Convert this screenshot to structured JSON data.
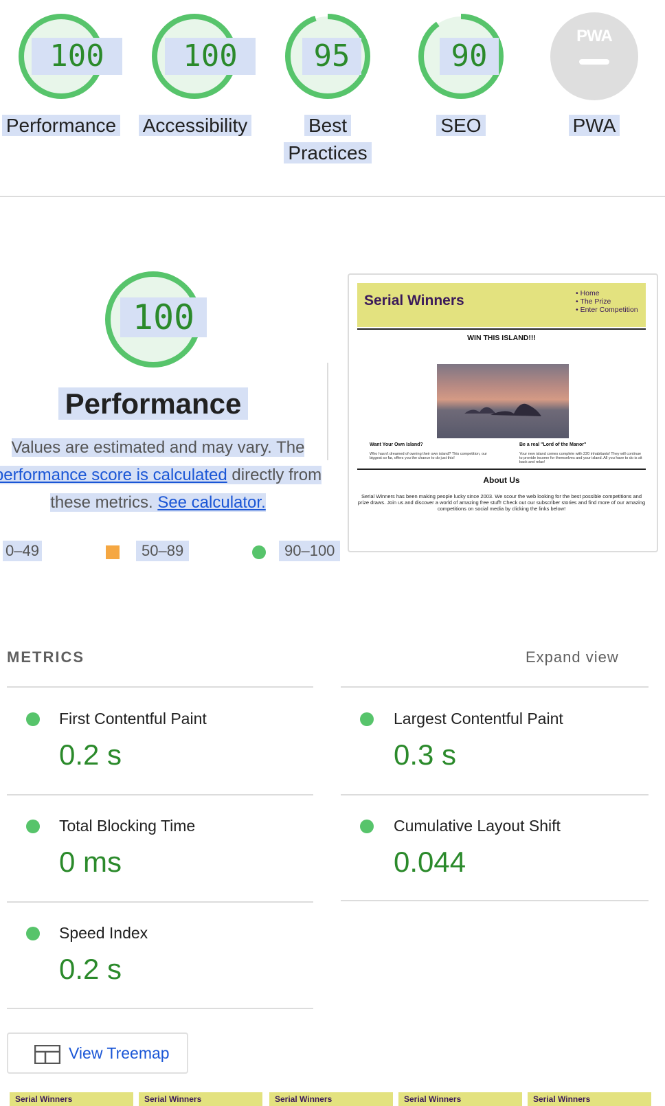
{
  "gauges": [
    {
      "score": "100",
      "label": "Performance",
      "fraction": 1.0
    },
    {
      "score": "100",
      "label": "Accessibility",
      "fraction": 1.0
    },
    {
      "score": "95",
      "label": "Best",
      "label2": "Practices",
      "fraction": 0.95
    },
    {
      "score": "90",
      "label": "SEO",
      "fraction": 0.9
    },
    {
      "score": "",
      "label": "PWA",
      "badge": "PWA"
    }
  ],
  "performance": {
    "score": "100",
    "title": "Performance",
    "desc_1": "Values are estimated and may vary. The",
    "link_calc": "performance score is calculated",
    "desc_2": "directly from",
    "desc_3": "these metrics.",
    "link_see": "See calculator.",
    "legend": [
      "0–49",
      "50–89",
      "90–100"
    ]
  },
  "screenshot": {
    "site_title": "Serial Winners",
    "nav": [
      "• Home",
      "• The Prize",
      "• Enter Competition"
    ],
    "headline": "WIN THIS ISLAND!!!",
    "col1_title": "Want Your Own Island?",
    "col1_text": "Who hasn't dreamed of owning their own island? This competition, our biggest so far, offers you the chance to do just this!",
    "col2_title": "Be a real \"Lord of the Manor\"",
    "col2_text": "Your new island comes complete with 220 inhabitants! They will continue to provide income for themselves and your island. All you have to do is sit back and relax!",
    "about_title": "About Us",
    "about_text": "Serial Winners has been making people lucky since 2003. We scour the web looking for the best possible competitions and prize draws. Join us and discover a world of amazing free stuff! Check out our subscriber stories and find more of our amazing competitions on social media by clicking the links below!"
  },
  "metrics": {
    "heading": "METRICS",
    "expand": "Expand view",
    "items": [
      {
        "title": "First Contentful Paint",
        "value": "0.2 s"
      },
      {
        "title": "Largest Contentful Paint",
        "value": "0.3 s"
      },
      {
        "title": "Total Blocking Time",
        "value": "0 ms"
      },
      {
        "title": "Cumulative Layout Shift",
        "value": "0.044"
      },
      {
        "title": "Speed Index",
        "value": "0.2 s"
      }
    ]
  },
  "treemap_label": "View Treemap",
  "filmstrip_title": "Serial Winners",
  "colors": {
    "pass": "#0cce6b",
    "average": "#ffa400",
    "fail": "#ff4e42",
    "score_text": "#2b8a2b"
  }
}
